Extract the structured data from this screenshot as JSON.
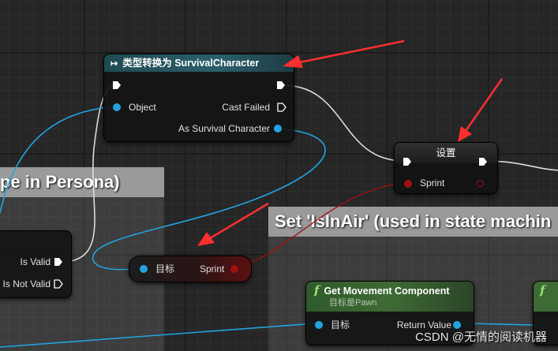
{
  "comments": {
    "left_title": "pe in Persona)",
    "right_title": "Set 'IsInAir' (used in state machin"
  },
  "cast_node": {
    "title": "类型转换为 SurvivalCharacter",
    "object_label": "Object",
    "cast_failed_label": "Cast Failed",
    "as_character_label": "As Survival Character"
  },
  "set_node": {
    "title": "设置",
    "sprint_label": "Sprint"
  },
  "isvalid_node": {
    "is_valid_label": "Is Valid",
    "is_not_valid_label": "Is Not Valid"
  },
  "target_node": {
    "target_label": "目标",
    "sprint_label": "Sprint"
  },
  "movement_node": {
    "title": "Get Movement Component",
    "subtitle": "目标是Pawn",
    "target_label": "目标",
    "return_label": "Return Value"
  },
  "watermark": "CSDN @无情的阅读机器",
  "colors": {
    "object_pin": "#22a3e0",
    "bool_pin": "#8c0000",
    "exec_pin": "#ffffff",
    "cast_header": "#2c5f6a",
    "function_header": "#3e6a34",
    "arrow": "#ff2f2f"
  },
  "icons": [
    "cast-icon",
    "function-icon"
  ]
}
